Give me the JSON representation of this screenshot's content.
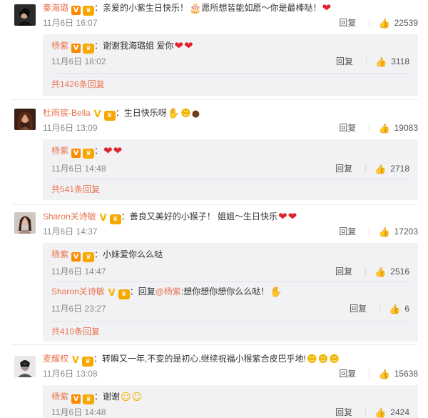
{
  "comments": [
    {
      "user": "秦海璐",
      "text": "：亲爱的小紫生日快乐！",
      "text2": "愿所想皆能如愿～你是最棒哒！",
      "time": "11月6日 16:07",
      "reply": "回复",
      "likes": "22539",
      "subs": [
        {
          "user": "杨紫",
          "text": "：谢谢我海璐姐 爱你",
          "time": "11月6日 18:02",
          "reply": "回复",
          "likes": "3118"
        }
      ],
      "more": "共1426条回复"
    },
    {
      "user": "杜雨宸-Bella",
      "text": "：生日快乐呀",
      "time": "11月6日 13:09",
      "reply": "回复",
      "likes": "19083",
      "subs": [
        {
          "user": "杨紫",
          "text": "：",
          "time": "11月6日 14:48",
          "reply": "回复",
          "likes": "2718"
        }
      ],
      "more": "共541条回复"
    },
    {
      "user": "Sharon关诗敏",
      "text": "：善良又美好的小猴子！ 姐姐～生日快乐",
      "time": "11月6日 14:37",
      "reply": "回复",
      "likes": "17203",
      "subs": [
        {
          "user": "杨紫",
          "text": "：小妹爱你么么哒",
          "time": "11月6日 14:47",
          "reply": "回复",
          "likes": "2516"
        },
        {
          "user": "Sharon关诗敏",
          "text_pre": "：回复",
          "mention": "@杨紫",
          "text": ":想你想你想你么么哒！",
          "time": "11月6日 23:27",
          "reply": "回复",
          "likes": "6"
        }
      ],
      "more": "共410条回复"
    },
    {
      "user": "麦耀权",
      "text": "：转瞬又一年,不变的是初心,继续祝福小猴紫合皮巴乎地!",
      "time": "11月6日 13:08",
      "reply": "回复",
      "likes": "15638",
      "subs": [
        {
          "user": "杨紫",
          "text": "：谢谢",
          "time": "11月6日 14:48",
          "reply": "回复",
          "likes": "2424"
        }
      ]
    }
  ],
  "badges": {
    "v_label": "V",
    "crown_label": "♛"
  },
  "icons": {
    "heart": "heart-icon",
    "cake": "cake-icon",
    "face": "smile-face-icon",
    "hand": "clap-hand-icon",
    "like": "thumbs-up-icon",
    "chocolate": "chocolate-icon"
  },
  "colors": {
    "username": "#eb7350",
    "text": "#333333",
    "meta": "#8a8a8a",
    "sub_bg": "#f2f2f5",
    "heart": "#e0242b",
    "badge_orange": "#ff8a00",
    "badge_gold": "#f6b300"
  }
}
